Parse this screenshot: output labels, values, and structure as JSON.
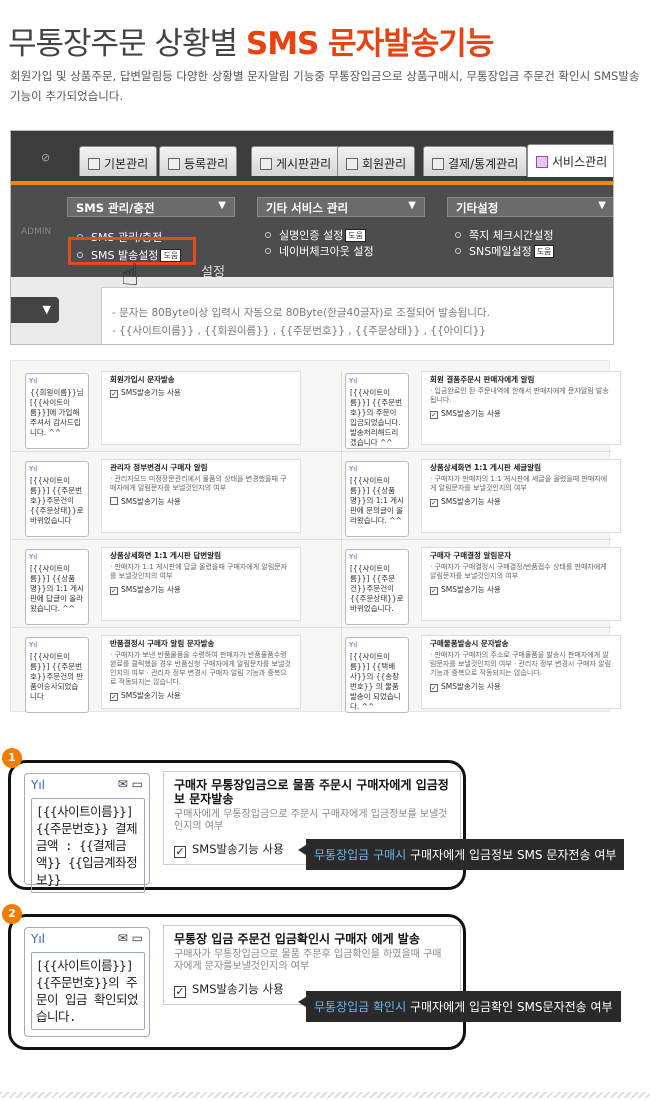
{
  "header": {
    "title_main": "무통장주문 상황별 ",
    "title_accent": "SMS 문자발송기능",
    "intro": "회원가입 및 상품주문, 답변알림등 다양한 상황별 문자알림 기능중 무통장입금으로 상품구매시, 무통장입금 주문건 확인시 SMS발송 기능이 추가되었습니다."
  },
  "admin_shot": {
    "tabs": [
      "기본관리",
      "등록관리",
      "게시판관리",
      "회원관리",
      "결제/통계관리",
      "서비스관리"
    ],
    "menu_heads": [
      "SMS 관리/충전",
      "기타 서비스 관리",
      "기타설정"
    ],
    "menu_items_col1": [
      "SMS 관리/충전",
      "SMS 발송설정"
    ],
    "menu_items_col2": [
      "실명인증 설정",
      "네이버체크아웃 설정"
    ],
    "menu_items_col3": [
      "쪽지 체크시간설정",
      "SNS메일설정"
    ],
    "badge": "도움",
    "admin_label": "ADMIN",
    "behind_text": "설정",
    "desc_line1": "- 문자는 80Byte이상 입력시 자동으로 80Byte(한글40글자)로 조절되어 발송됩니다.",
    "desc_line2": "- {{사이트이름}} , {{회원이름}} , {{주문번호}} , {{주문상태}} , {{아이디}}"
  },
  "cards": [
    {
      "msg": "{{회원이름}}님 [{{사이트이름}}]에 가입해주셔서 감사드립니다. ^^",
      "title": "회원가입시 문자발송",
      "desc": "",
      "check": "SMS발송기능 사용",
      "checked": true
    },
    {
      "msg": "[{{사이트이름}}] {{주문번호}}의 주문이 입금되었습니다. 발송처리해드리겠습니다 ^^",
      "title": "회원 결품주문시 판매자에게 알림",
      "desc": "· 입금완료인 된 주문내역에 한해서 판매자에게 문자알림 발송됩니다.",
      "check": "SMS발송기능 사용",
      "checked": true
    },
    {
      "msg": "[{{사이트이름}}] {{주문번호}}주문건이 {{주문상태}}로 바뀌었습니다",
      "title": "관리자 정부변경시 구매자 알림",
      "desc": "· 관리자모드 미정장문관리에서 물품의 상태을 변경했을때 구매자에게 알림문자를 보낼것인지의 여부",
      "check": "SMS발송기능 사용",
      "checked": false
    },
    {
      "msg": "[{{사이트이름}}] {{상품명}}의 1:1 게시판에 문의글이 올라왔습니다. ^^",
      "title": "상품상세화면 1:1 게시판 세글알림",
      "desc": "· 구매자가 판매자의 1:1 게시판에 세글을 올렸을때 판매자에게 알림문자를 보낼것인지의 여부",
      "check": "SMS발송기능 사용",
      "checked": true
    },
    {
      "msg": "[{{사이트이름}}] {{상품명}}의 1:1 게시판에 답글이 올라왔습니다. ^^",
      "title": "상품상세화면 1:1 게시판 답변알림",
      "desc": "· 판매자가 1:1 게시판에 답글 올렸을때 구매자에게 알림문자를 보낼것인지의 여부",
      "check": "SMS발송기능 사용",
      "checked": true
    },
    {
      "msg": "[{{사이트이름}}] {{주문건}}주문건이 {{주문상태}}로 바뀌었습니다.",
      "title": "구매자 구매결정 알림문자",
      "desc": "· 구매자가 구매결정시 구매결정/반품접수 상태를 판매자에게 알림문자를 보낼것인지의 여부",
      "check": "SMS발송기능 사용",
      "checked": true
    },
    {
      "msg": "[{{사이트이름}}] {{주문번호}}주문건의 반품이승사되었습니다",
      "title": "반품결정시 구매자 알림 문자발송",
      "desc": "· 구매자가 보낸 반품물품을 수령하여 판매자가 반품물품수령완료를 클릭했을 경우 반품신청 구매자에게 알림문자를 보낼것인지의 여부 · 관리자 정부 변경시 구매자 알림 기능과 중복으로 작동되지는 않습니다.",
      "check": "SMS발송기능 사용",
      "checked": true
    },
    {
      "msg": "[{{사이트이름}}] {{택배사}}의 {{송장번호}} 의 물품발송이 되었습니다. ^^",
      "title": "구매물품발송시 문자발송",
      "desc": "· 판매자가 구매자의 주소로 구매물품을 발송시 판매자에게 알림문자를 보낼것인지의 여부 · 관리자 정부 변경시 구매자 알림 기능과 중복으로 작동되지는 않습니다.",
      "check": "SMS발송기능 사용",
      "checked": true
    }
  ],
  "feature1": {
    "num": "1",
    "msg": "[{{사이트이름}}] {{주문번호}} 결제금액 : {{결제금액}} {{입금계좌정보}}",
    "title": "구매자 무통장입금으로 물품 주문시 구매자에게 입금정보 문자발송",
    "desc": "구매자에게 무통장입금으로 주문시 구매자에게 입금정보를 보낼것인지의 여부",
    "check": "SMS발송기능 사용",
    "note_blue": "무통장입금 구매시",
    "note_rest": " 구매자에게 입금정보 SMS 문자전송 여부"
  },
  "feature2": {
    "num": "2",
    "msg": "[{{사이트이름}}] {{주문번호}}의 주문이 입금 확인되었습니다.",
    "title": "무통장 입금 주문건 입금확인시 구매자 에게 발송",
    "desc": "구매자가 무통장입금으로 물품 주문후 입금확인을 하였을때 구매자에게 문자를보낼것인지의 여부",
    "check": "SMS발송기능 사용",
    "note_blue": "무통장입금 확인시",
    "note_rest": " 구매자에게 입금확인 SMS문자전송 여부"
  }
}
